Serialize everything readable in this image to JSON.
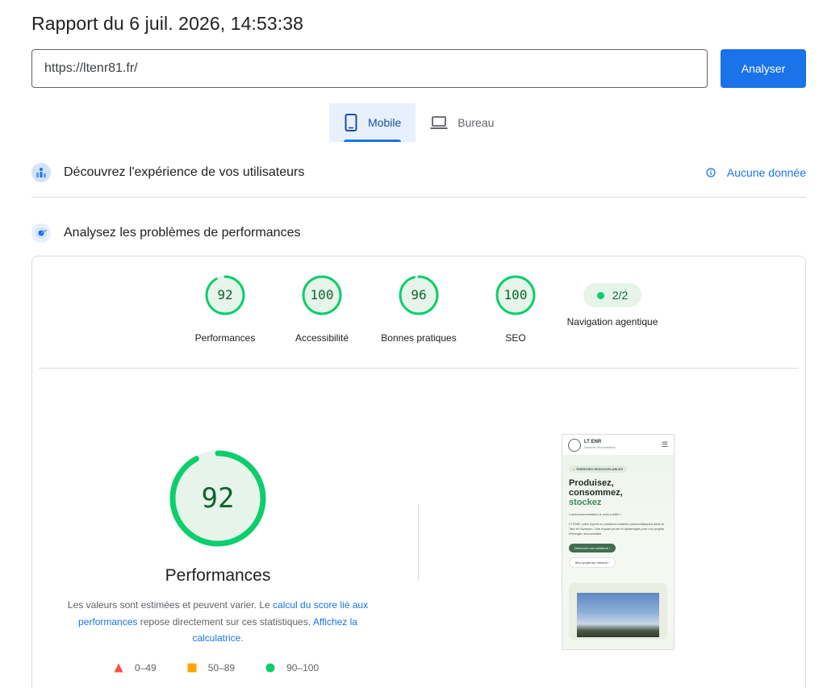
{
  "report": {
    "title": "Rapport du 6 juil. 2026, 14:53:38",
    "url_value": "https://ltenr81.fr/",
    "analyze_label": "Analyser"
  },
  "device_tabs": [
    {
      "label": "Mobile",
      "icon": "smartphone-icon",
      "active": true
    },
    {
      "label": "Bureau",
      "icon": "laptop-icon",
      "active": false
    }
  ],
  "field_data": {
    "title": "Découvrez l'expérience de vos utilisateurs",
    "status": "Aucune donnée",
    "icon": "users-chart-icon"
  },
  "lab_data": {
    "title": "Analysez les problèmes de performances",
    "icon": "lighthouse-icon"
  },
  "gauges": [
    {
      "label": "Performances",
      "score": "92",
      "score_value": 92
    },
    {
      "label": "Accessibilité",
      "score": "100",
      "score_value": 100
    },
    {
      "label": "Bonnes pratiques",
      "score": "96",
      "score_value": 96
    },
    {
      "label": "SEO",
      "score": "100",
      "score_value": 100
    }
  ],
  "agentic": {
    "value": "2/2",
    "label": "Navigation agentique"
  },
  "performance": {
    "score": "92",
    "score_value": 92,
    "title": "Performances",
    "disclaimer_prefix": "Les valeurs sont estimées et peuvent varier. Le ",
    "link_score_calc": "calcul du score lié aux performances",
    "disclaimer_middle": " repose directement sur ces statistiques. ",
    "link_calculator": "Affichez la calculatrice",
    "disclaimer_suffix": "."
  },
  "legend": [
    {
      "range": "0–49",
      "shape": "triangle",
      "color": "#ff4e42"
    },
    {
      "range": "50–89",
      "shape": "square",
      "color": "#ffa400"
    },
    {
      "range": "90–100",
      "shape": "circle",
      "color": "#0cce6b"
    }
  ],
  "screenshot": {
    "brand": "LT ENR",
    "brand_sub": "Solutions Renouvelables",
    "badge": "ÉNERGIES RENOUVELABLES",
    "headline_line1": "Produisez,",
    "headline_line2": "consommez,",
    "headline_accent": "stockez",
    "intro": "L'autoconsommation à votre portée !",
    "body": "LT ENR, votre expert en solutions solaires photovoltaïques dans le Tarn et l'Aveyron. Une équipe jeune et dynamique pour vos projets d'énergie renouvelable.",
    "btn_primary": "Découvrir nos solutions  ›",
    "btn_secondary": "Mon projet sur mesure  ›"
  },
  "colors": {
    "accent": "#1a73e8",
    "pass": "#0cce6b",
    "pass_text": "#0d652d",
    "pass_bg": "#e6f4ea"
  }
}
